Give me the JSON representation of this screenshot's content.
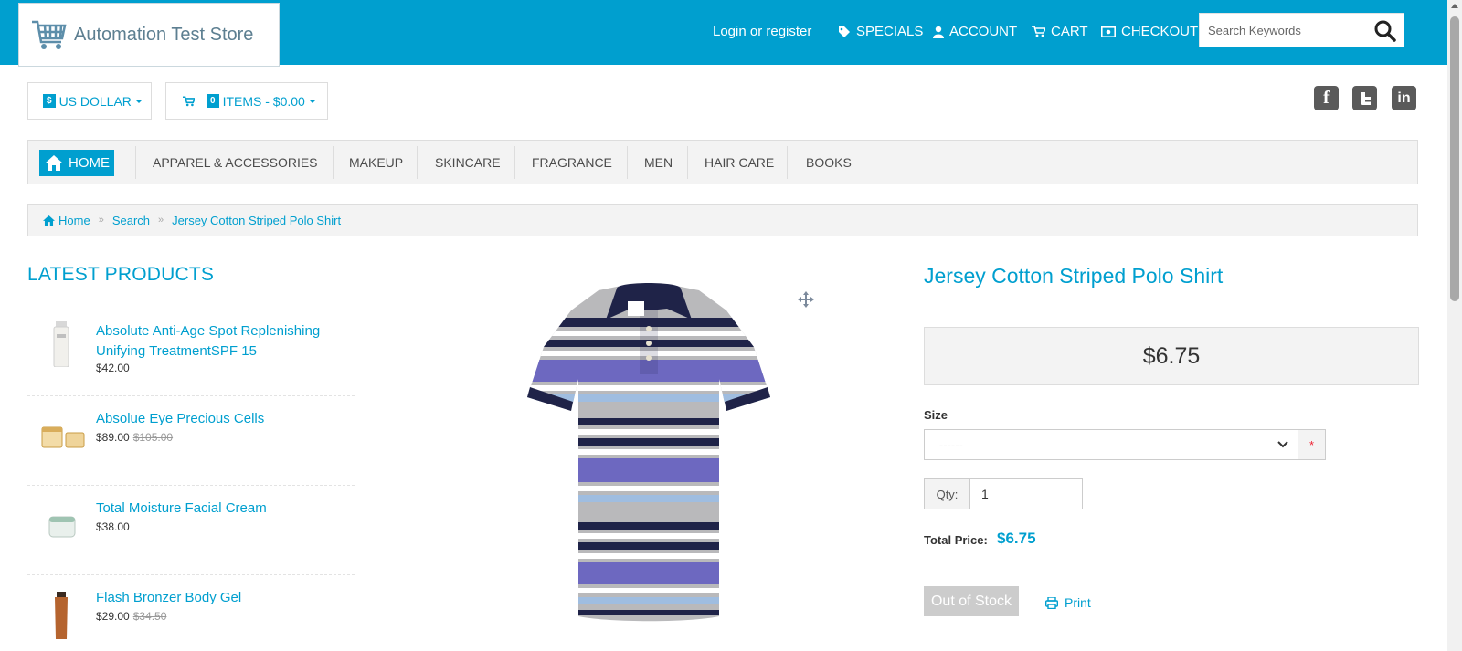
{
  "header": {
    "logo_text": "Automation Test Store",
    "links": {
      "login": "Login or register",
      "specials": "SPECIALS",
      "account": "ACCOUNT",
      "cart": "CART",
      "checkout": "CHECKOUT"
    },
    "search_placeholder": "Search Keywords"
  },
  "currency": {
    "symbol": "$",
    "label": "US DOLLAR"
  },
  "mini_cart": {
    "count": "0",
    "label": "ITEMS - $0.00"
  },
  "social": [
    "facebook-icon",
    "twitter-icon",
    "linkedin-icon"
  ],
  "nav": {
    "home": "HOME",
    "items": [
      "APPAREL & ACCESSORIES",
      "MAKEUP",
      "SKINCARE",
      "FRAGRANCE",
      "MEN",
      "HAIR CARE",
      "BOOKS"
    ]
  },
  "breadcrumb": [
    "Home",
    "Search",
    "Jersey Cotton Striped Polo Shirt"
  ],
  "latest": {
    "title": "LATEST PRODUCTS",
    "items": [
      {
        "name_line1": "Absolute Anti-Age Spot Replenishing",
        "name_line2": "Unifying TreatmentSPF 15",
        "price": "$42.00",
        "old_price": ""
      },
      {
        "name_line1": "Absolue Eye Precious Cells",
        "name_line2": "",
        "price": "$89.00",
        "old_price": "$105.00"
      },
      {
        "name_line1": "Total Moisture Facial Cream",
        "name_line2": "",
        "price": "$38.00",
        "old_price": ""
      },
      {
        "name_line1": "Flash Bronzer Body Gel",
        "name_line2": "",
        "price": "$29.00",
        "old_price": "$34.50"
      }
    ]
  },
  "product": {
    "title": "Jersey Cotton Striped Polo Shirt",
    "price": "$6.75",
    "size_label": "Size",
    "size_value": "------",
    "required_mark": "*",
    "qty_label": "Qty:",
    "qty_value": "1",
    "total_label": "Total Price:",
    "total_value": "$6.75",
    "stock_button": "Out of Stock",
    "print_label": "Print"
  },
  "colors": {
    "accent": "#009fcf",
    "nav_bg": "#f3f3f3",
    "social": "#5a5a5a",
    "disabled": "#cccccc"
  }
}
